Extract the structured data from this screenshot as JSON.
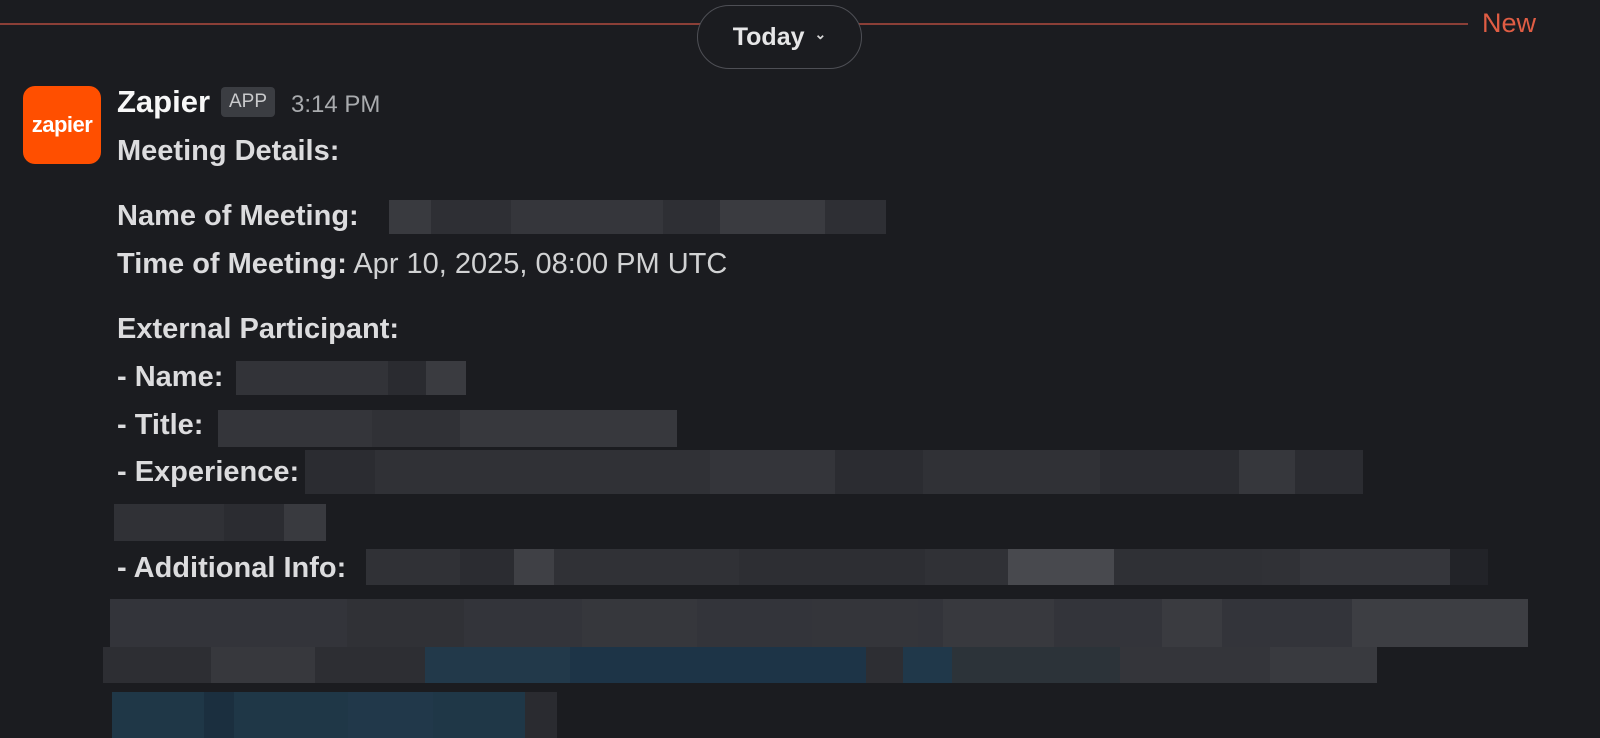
{
  "divider": {
    "date_label": "Today",
    "new_label": "New",
    "accent_color": "#e05d44"
  },
  "message": {
    "avatar_text": "zapier",
    "avatar_color": "#ff4f00",
    "sender": "Zapier",
    "badge": "APP",
    "time": "3:14 PM",
    "heading": "Meeting Details:",
    "name_label": "Name of Meeting:",
    "time_label": "Time of Meeting:",
    "time_value": "Apr 10, 2025, 08:00 PM UTC",
    "participant_heading": "External Participant:",
    "participant_name_label": "- Name:",
    "participant_title_label": "- Title:",
    "participant_experience_label": "- Experience:",
    "participant_additional_label": "- Additional Info:"
  },
  "icons": {
    "chevron": "chevron-down-icon"
  }
}
